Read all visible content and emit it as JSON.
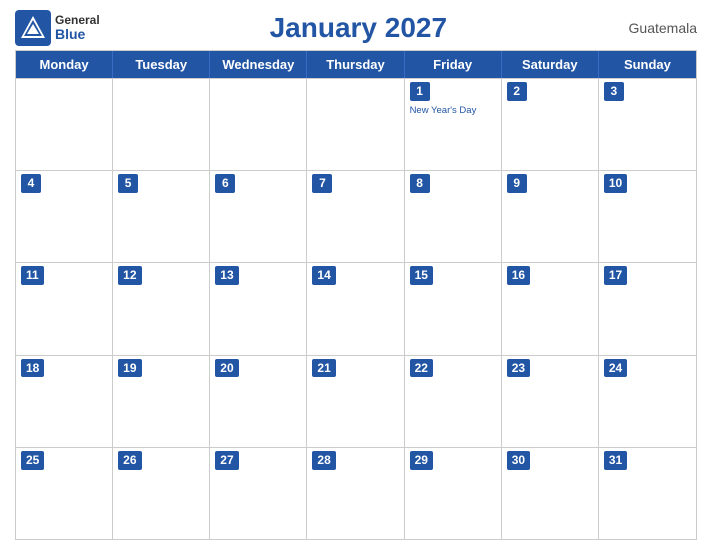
{
  "header": {
    "logo_general": "General",
    "logo_blue": "Blue",
    "title": "January 2027",
    "country": "Guatemala"
  },
  "dayHeaders": [
    "Monday",
    "Tuesday",
    "Wednesday",
    "Thursday",
    "Friday",
    "Saturday",
    "Sunday"
  ],
  "weeks": [
    [
      {
        "num": "",
        "empty": true
      },
      {
        "num": "",
        "empty": true
      },
      {
        "num": "",
        "empty": true
      },
      {
        "num": "",
        "empty": true
      },
      {
        "num": "1",
        "holiday": "New Year's Day"
      },
      {
        "num": "2"
      },
      {
        "num": "3"
      }
    ],
    [
      {
        "num": "4"
      },
      {
        "num": "5"
      },
      {
        "num": "6"
      },
      {
        "num": "7"
      },
      {
        "num": "8"
      },
      {
        "num": "9"
      },
      {
        "num": "10"
      }
    ],
    [
      {
        "num": "11"
      },
      {
        "num": "12"
      },
      {
        "num": "13"
      },
      {
        "num": "14"
      },
      {
        "num": "15"
      },
      {
        "num": "16"
      },
      {
        "num": "17"
      }
    ],
    [
      {
        "num": "18"
      },
      {
        "num": "19"
      },
      {
        "num": "20"
      },
      {
        "num": "21"
      },
      {
        "num": "22"
      },
      {
        "num": "23"
      },
      {
        "num": "24"
      }
    ],
    [
      {
        "num": "25"
      },
      {
        "num": "26"
      },
      {
        "num": "27"
      },
      {
        "num": "28"
      },
      {
        "num": "29"
      },
      {
        "num": "30"
      },
      {
        "num": "31"
      }
    ]
  ]
}
